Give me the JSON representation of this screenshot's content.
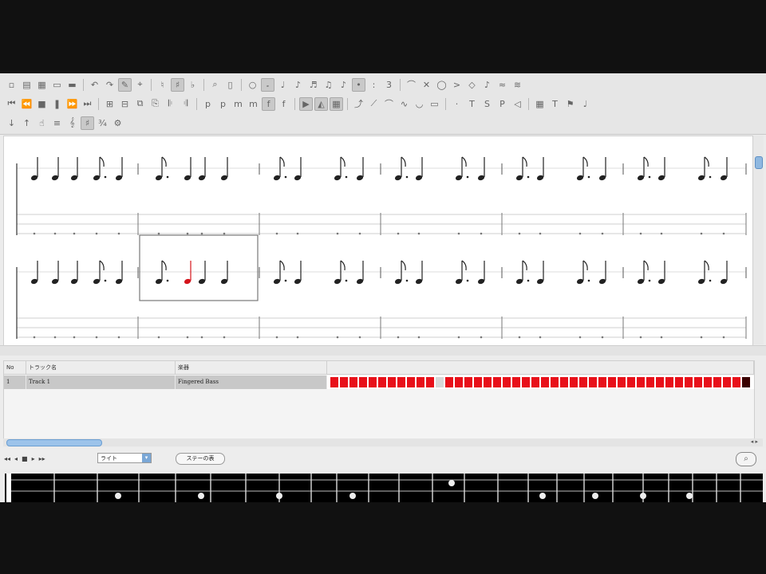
{
  "track_table": {
    "header_no": "No",
    "header_name": "トラック名",
    "header_instrument": "楽器",
    "rows": [
      {
        "no": "1",
        "name": "Track 1",
        "instrument": "Fingered Bass"
      }
    ],
    "measure_count": 44,
    "cursor_measure": 11
  },
  "transport": {
    "mode_select": "ライト",
    "settings_button": "ステーの表"
  },
  "icons": {
    "toolbar": [
      "new-file-icon",
      "open-file-icon",
      "save-icon",
      "print-icon",
      "undo-icon",
      "redo-icon",
      "edit-mode-icon",
      "note-duration-icon",
      "dotted-note-icon",
      "tuplet-icon",
      "dynamics-icon",
      "effects-icon",
      "playback-icon",
      "zoom-icon"
    ],
    "score_scroll": "scroll-up-icon",
    "transport": [
      "first-measure-icon",
      "previous-measure-icon",
      "play-icon",
      "stop-icon",
      "next-measure-icon",
      "last-measure-icon",
      "magnifier-icon"
    ]
  },
  "colors": {
    "selected_note": "#d4141c",
    "measure_cell": "#e8101a",
    "fretboard": "#000000"
  }
}
